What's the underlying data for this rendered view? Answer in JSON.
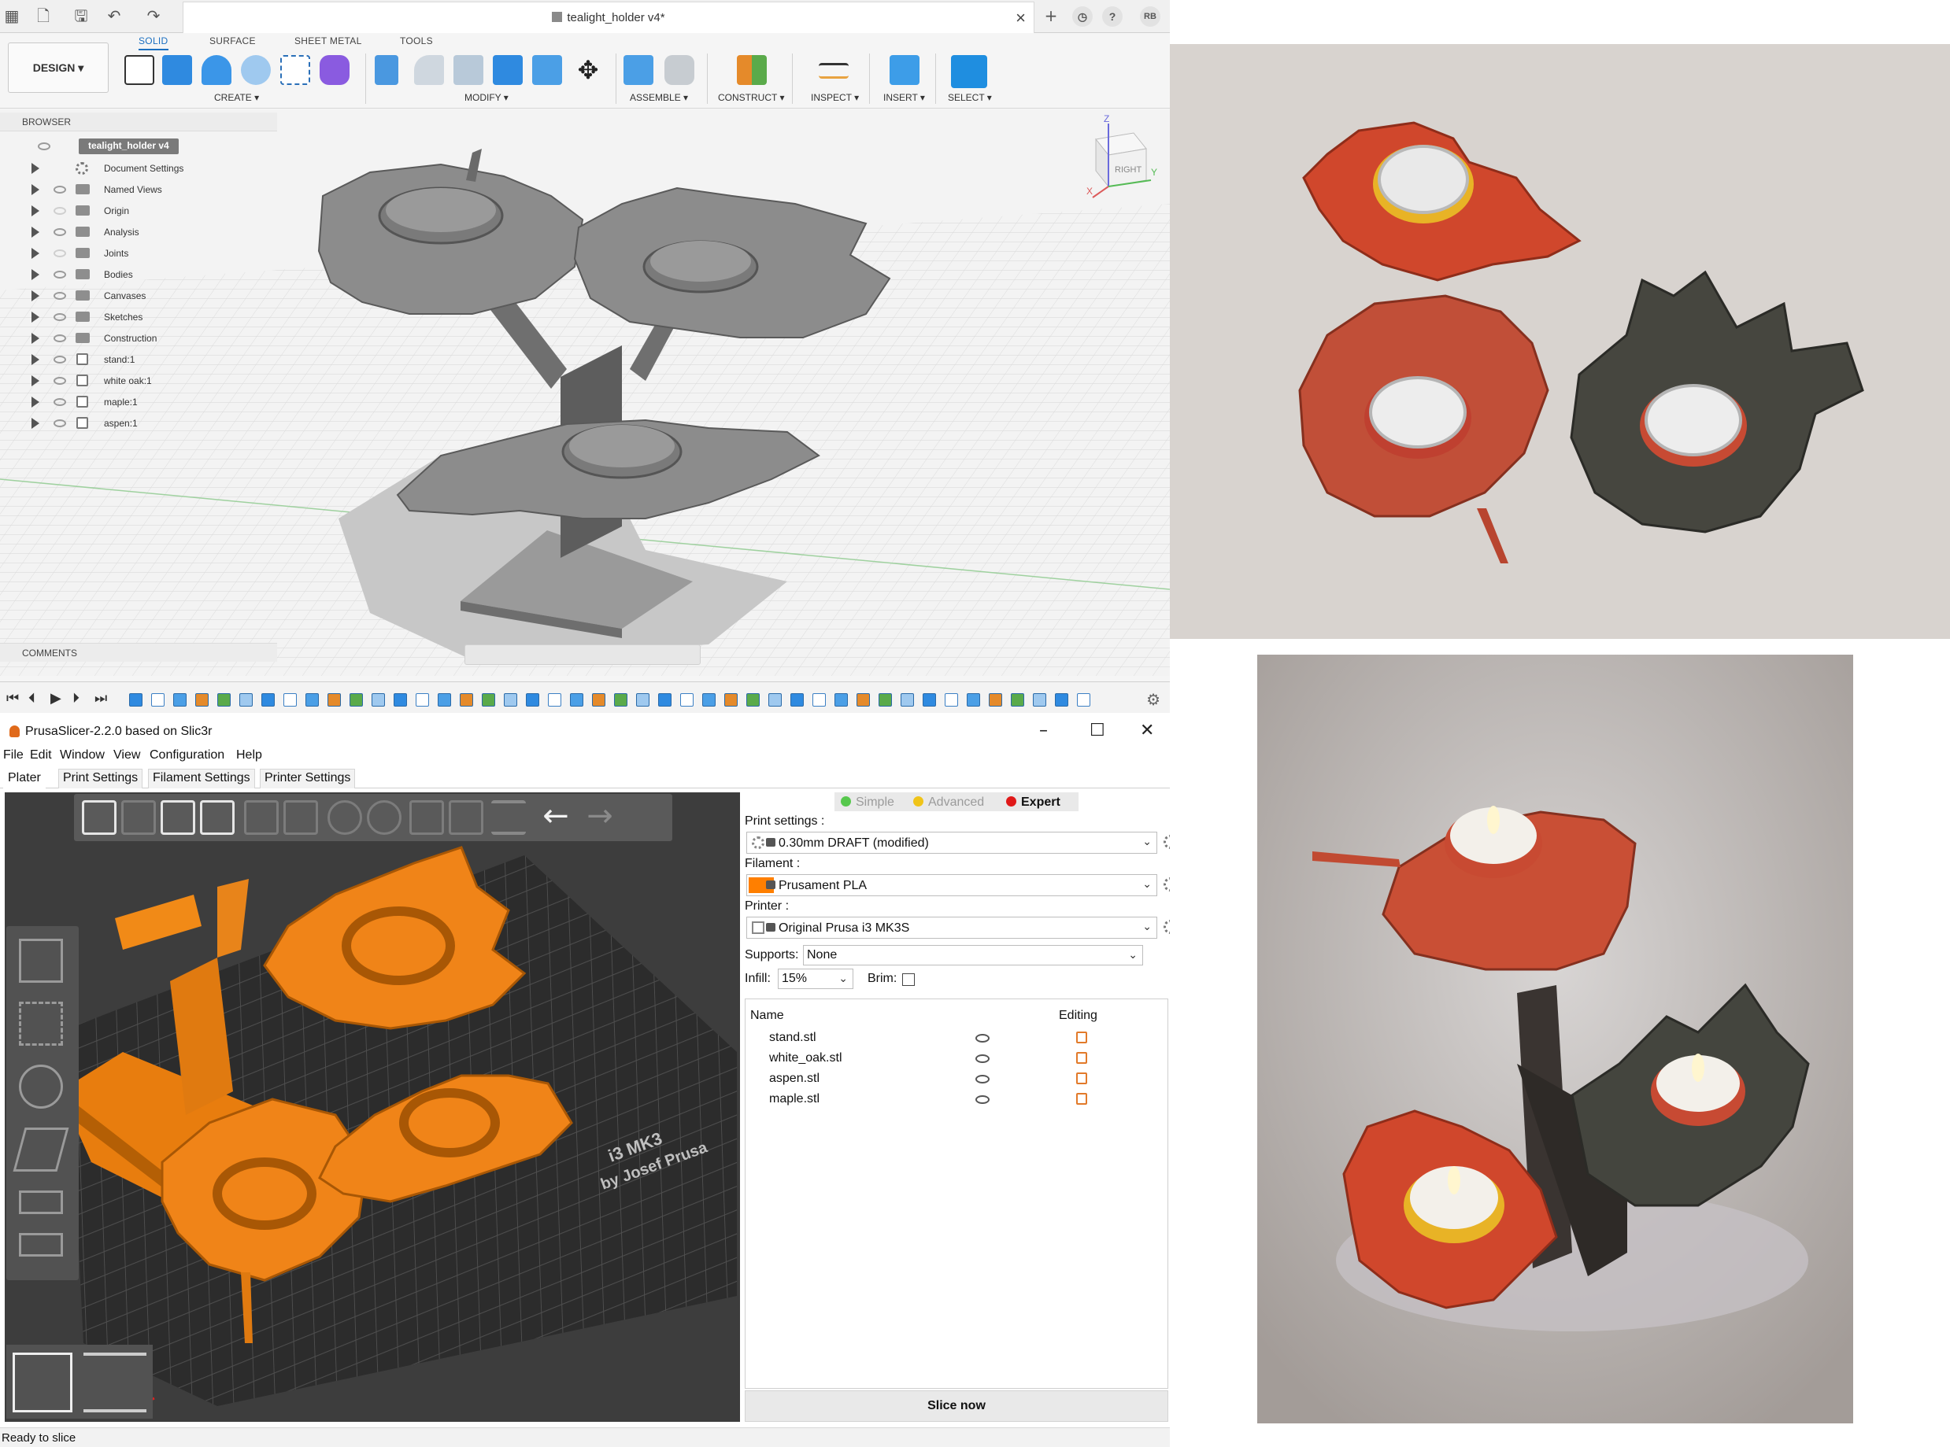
{
  "fusion": {
    "doc_title": "tealight_holder v4*",
    "user_initials": "RB",
    "workspace": "DESIGN ▾",
    "tabs": [
      "SOLID",
      "SURFACE",
      "SHEET METAL",
      "TOOLS"
    ],
    "groups": [
      "CREATE ▾",
      "MODIFY ▾",
      "ASSEMBLE ▾",
      "CONSTRUCT ▾",
      "INSPECT ▾",
      "INSERT ▾",
      "SELECT ▾"
    ],
    "browser": {
      "title": "BROWSER",
      "root": "tealight_holder v4",
      "items": [
        {
          "label": "Document Settings",
          "icon": "gear-icon"
        },
        {
          "label": "Named Views",
          "icon": "folder-icon"
        },
        {
          "label": "Origin",
          "icon": "folder-icon"
        },
        {
          "label": "Analysis",
          "icon": "folder-icon"
        },
        {
          "label": "Joints",
          "icon": "folder-icon"
        },
        {
          "label": "Bodies",
          "icon": "folder-icon"
        },
        {
          "label": "Canvases",
          "icon": "folder-icon"
        },
        {
          "label": "Sketches",
          "icon": "folder-icon"
        },
        {
          "label": "Construction",
          "icon": "folder-icon"
        },
        {
          "label": "stand:1",
          "icon": "component-icon"
        },
        {
          "label": "white oak:1",
          "icon": "component-icon"
        },
        {
          "label": "maple:1",
          "icon": "component-icon"
        },
        {
          "label": "aspen:1",
          "icon": "component-icon"
        }
      ]
    },
    "comments_label": "COMMENTS",
    "viewcube_label": "RIGHT",
    "axis_labels": {
      "z": "Z",
      "x": "X",
      "y": "Y"
    }
  },
  "prusa": {
    "window_title": "PrusaSlicer-2.2.0 based on Slic3r",
    "menu": [
      "File",
      "Edit",
      "Window",
      "View",
      "Configuration",
      "Help"
    ],
    "tabs": [
      "Plater",
      "Print Settings",
      "Filament Settings",
      "Printer Settings"
    ],
    "modes": [
      {
        "label": "Simple",
        "color": "#57c84d"
      },
      {
        "label": "Advanced",
        "color": "#f0c419"
      },
      {
        "label": "Expert",
        "color": "#e01919"
      }
    ],
    "print_settings_label": "Print settings :",
    "print_settings_value": "0.30mm DRAFT (modified)",
    "filament_label": "Filament :",
    "filament_value": "Prusament PLA",
    "filament_color": "#ff7f00",
    "printer_label": "Printer :",
    "printer_value": "Original Prusa i3 MK3S",
    "supports_label": "Supports:",
    "supports_value": "None",
    "infill_label": "Infill:",
    "infill_value": "15%",
    "brim_label": "Brim:",
    "col_name": "Name",
    "col_editing": "Editing",
    "objects": [
      "stand.stl",
      "white_oak.stl",
      "aspen.stl",
      "maple.stl"
    ],
    "slice_button": "Slice now",
    "status": "Ready to slice",
    "bed_text": "i3 MK3\nby Josef Prusa"
  }
}
